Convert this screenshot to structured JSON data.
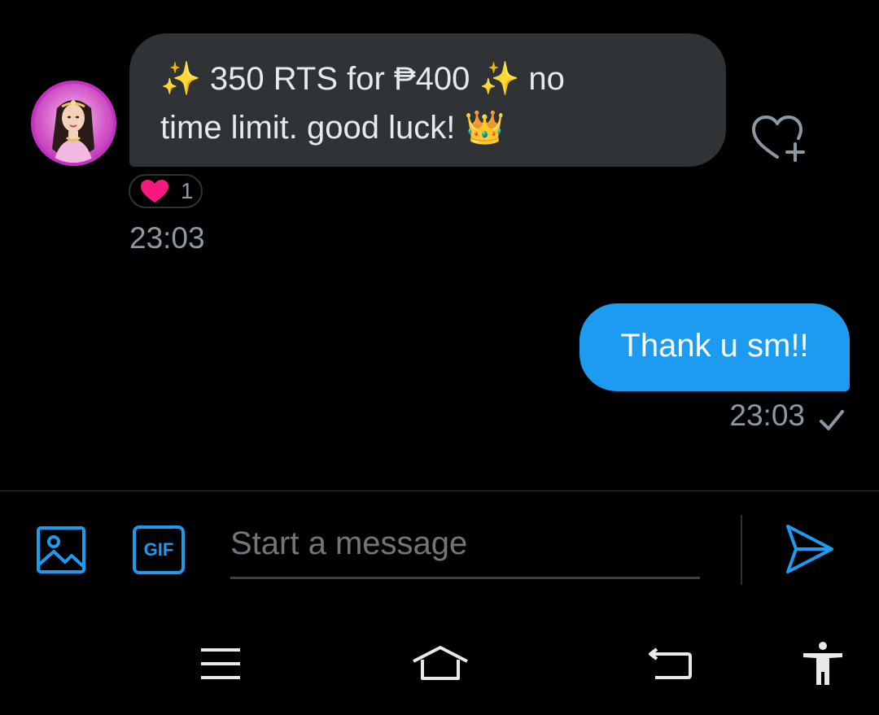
{
  "received": {
    "text_line1": "✨ 350 RTS for ₱400 ✨ no",
    "text_line2": "time limit. good luck! 👑",
    "reaction": {
      "icon": "heart-icon",
      "count": "1",
      "color": "#f91880"
    },
    "time": "23:03"
  },
  "sent": {
    "text": "Thank u sm!!",
    "time": "23:03",
    "status_icon": "checkmark-icon"
  },
  "composer": {
    "placeholder": "Start a message",
    "value": "",
    "gif_label": "GIF",
    "media_icon": "image-icon",
    "send_icon": "send-icon"
  },
  "system_nav": {
    "icons": [
      "menu-icon",
      "home-icon",
      "back-icon",
      "accessibility-icon"
    ]
  },
  "colors": {
    "background": "#000000",
    "received_bubble": "#2f3336",
    "sent_bubble": "#1d9bf0",
    "accent": "#1d9bf0",
    "secondary_text": "#8b98a5"
  }
}
